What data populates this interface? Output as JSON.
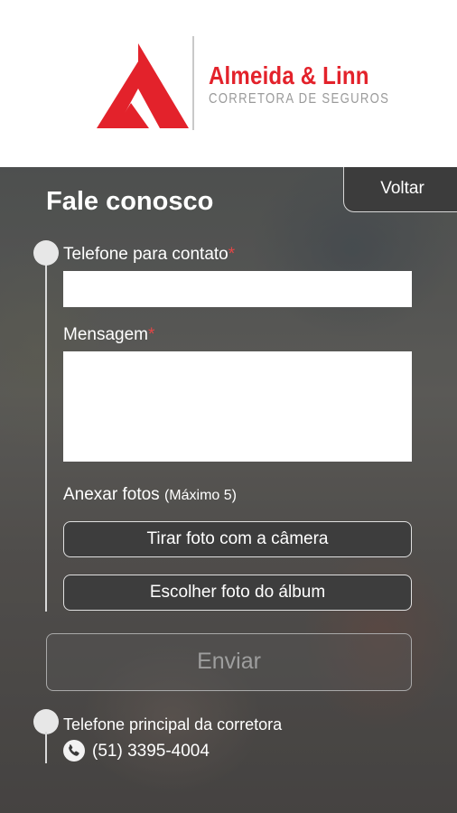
{
  "brand": {
    "name": "Almeida & Linn",
    "tagline": "CORRETORA DE SEGUROS",
    "color": "#e3222b"
  },
  "nav": {
    "back_label": "Voltar"
  },
  "page": {
    "title": "Fale conosco"
  },
  "form": {
    "phone_label": "Telefone para contato",
    "phone_value": "",
    "message_label": "Mensagem",
    "message_value": "",
    "required_mark": "*",
    "attach_label": "Anexar fotos",
    "attach_hint": "(Máximo 5)",
    "camera_button": "Tirar foto com a câmera",
    "album_button": "Escolher foto do álbum",
    "submit_button": "Enviar"
  },
  "contact": {
    "label": "Telefone principal da corretora",
    "phone_icon": "phone-icon",
    "phone": "(51) 3395-4004"
  }
}
